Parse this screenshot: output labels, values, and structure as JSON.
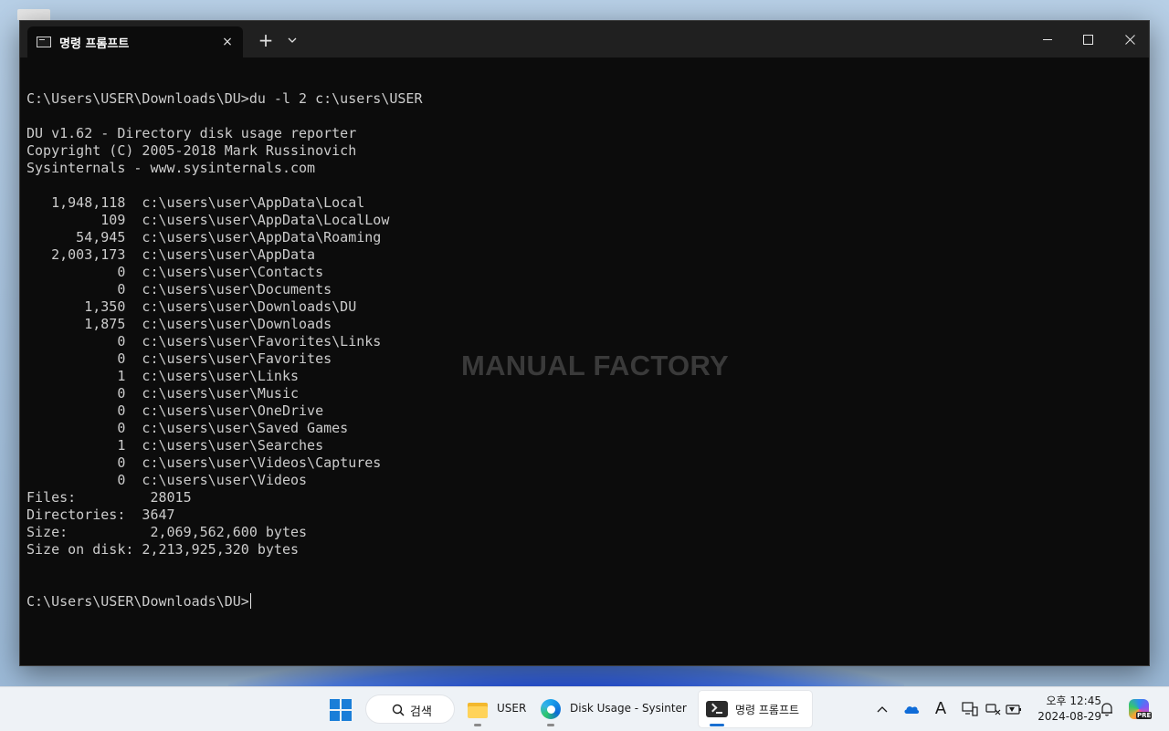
{
  "window": {
    "tab_title": "명령 프롬프트",
    "tab_close": "×",
    "new_tab": "+"
  },
  "terminal": {
    "lines": [
      "",
      "C:\\Users\\USER\\Downloads\\DU>du -l 2 c:\\users\\USER",
      "",
      "DU v1.62 - Directory disk usage reporter",
      "Copyright (C) 2005-2018 Mark Russinovich",
      "Sysinternals - www.sysinternals.com",
      "",
      "   1,948,118  c:\\users\\user\\AppData\\Local",
      "         109  c:\\users\\user\\AppData\\LocalLow",
      "      54,945  c:\\users\\user\\AppData\\Roaming",
      "   2,003,173  c:\\users\\user\\AppData",
      "           0  c:\\users\\user\\Contacts",
      "           0  c:\\users\\user\\Documents",
      "       1,350  c:\\users\\user\\Downloads\\DU",
      "       1,875  c:\\users\\user\\Downloads",
      "           0  c:\\users\\user\\Favorites\\Links",
      "           0  c:\\users\\user\\Favorites",
      "           1  c:\\users\\user\\Links",
      "           0  c:\\users\\user\\Music",
      "           0  c:\\users\\user\\OneDrive",
      "           0  c:\\users\\user\\Saved Games",
      "           1  c:\\users\\user\\Searches",
      "           0  c:\\users\\user\\Videos\\Captures",
      "           0  c:\\users\\user\\Videos",
      "Files:         28015",
      "Directories:  3647",
      "Size:          2,069,562,600 bytes",
      "Size on disk: 2,213,925,320 bytes",
      "",
      ""
    ],
    "prompt": "C:\\Users\\USER\\Downloads\\DU>"
  },
  "watermark": "MANUAL FACTORY",
  "taskbar": {
    "search_label": "검색",
    "apps": [
      {
        "label": "USER",
        "icon": "folder-icon"
      },
      {
        "label": "Disk Usage - Sysinternal",
        "icon": "edge-icon"
      },
      {
        "label": "명령 프롬프트",
        "icon": "terminal-icon"
      }
    ],
    "tray": {
      "chevron": "^",
      "ime": "A",
      "clock_time": "오후 12:45",
      "clock_date": "2024-08-29",
      "copilot_badge": "PRE"
    }
  }
}
